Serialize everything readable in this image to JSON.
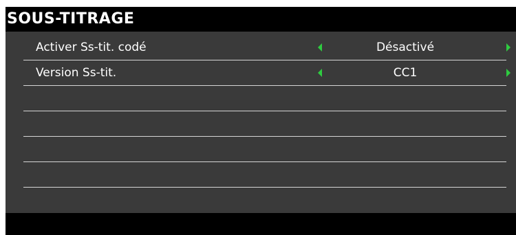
{
  "menu": {
    "title": "SOUS-TITRAGE",
    "items": [
      {
        "label": "Activer Ss-tit. codé",
        "value": "Désactivé"
      },
      {
        "label": "Version Ss-tit.",
        "value": "CC1"
      },
      {
        "label": "",
        "value": ""
      },
      {
        "label": "",
        "value": ""
      },
      {
        "label": "",
        "value": ""
      },
      {
        "label": "",
        "value": ""
      }
    ]
  },
  "colors": {
    "arrow": "#2ecc40",
    "panel": "#3a3a3a",
    "frame": "#000000",
    "text": "#ffffff"
  }
}
